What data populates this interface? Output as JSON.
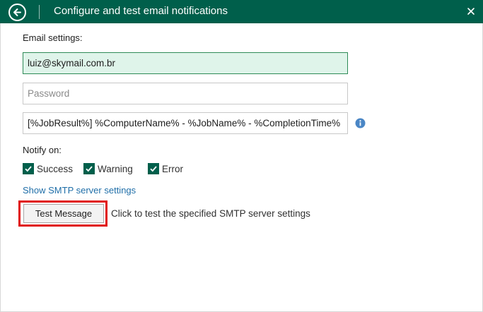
{
  "window": {
    "title": "Configure and test email notifications",
    "accent_color": "#005f4b"
  },
  "email_settings": {
    "heading": "Email settings:",
    "recipient_value": "luiz@skymail.com.br",
    "password_placeholder": "Password",
    "subject_value": "[%JobResult%] %ComputerName% - %JobName% - %CompletionTime%"
  },
  "notify": {
    "heading": "Notify on:",
    "options": [
      {
        "label": "Success",
        "checked": true
      },
      {
        "label": "Warning",
        "checked": true
      },
      {
        "label": "Error",
        "checked": true
      }
    ]
  },
  "smtp_link": "Show SMTP server settings",
  "test": {
    "button_label": "Test Message",
    "description": "Click to test the specified SMTP server settings",
    "highlight_color": "#e01010"
  },
  "icons": {
    "back": "back-arrow-circle-icon",
    "close": "close-icon",
    "info": "info-icon",
    "check": "checkmark-icon"
  }
}
